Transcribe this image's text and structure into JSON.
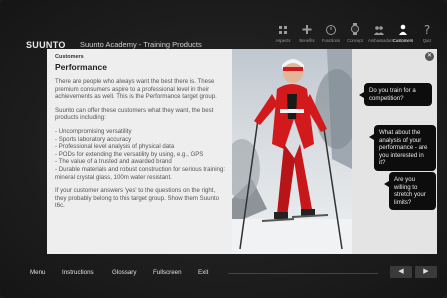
{
  "header": {
    "brand": "SUUNTO",
    "title": "Suunto Academy - Training Products",
    "nav": [
      {
        "label": "Aspects",
        "icon": "grid-icon",
        "active": false
      },
      {
        "label": "Benefits",
        "icon": "plus-icon",
        "active": false
      },
      {
        "label": "Functions",
        "icon": "stopwatch-icon",
        "active": false
      },
      {
        "label": "Concept",
        "icon": "watch-icon",
        "active": false
      },
      {
        "label": "Ambassadors",
        "icon": "people-icon",
        "active": false
      },
      {
        "label": "Customers",
        "icon": "person-icon",
        "active": true
      },
      {
        "label": "Quiz",
        "icon": "question-icon",
        "active": false
      }
    ]
  },
  "content": {
    "section_label": "Customers",
    "section_title": "Performance",
    "paragraphs": [
      "There are people who always want the best there is. These premium consumers aspire to a professional level in their achievements as well. This is the Performance target group.",
      "Suunto can offer these customers what they want, the best products including:"
    ],
    "bullets": [
      "- Uncompromising versatility",
      "- Sports laboratory accuracy",
      "- Professional level analysis of physical data",
      "- PODs for extending the versatility by using, e.g., GPS",
      "- The value of a trusted and awarded brand",
      "- Durable materials and robust construction for serious training: mineral crystal glass, 100m water resistant."
    ],
    "closing": "If your customer answers 'yes' to the questions on the right, they probably belong to this target group. Show them Suunto t6c."
  },
  "questions": [
    "Do you train for a competition?",
    "What about the analysis of your performance - are you interested in it?",
    "Are you willing to stretch your limits?"
  ],
  "footer": {
    "menu": "Menu",
    "instructions": "Instructions",
    "glossary": "Glossary",
    "fullscreen": "Fullscreen",
    "exit": "Exit",
    "prev": "◀",
    "next": "▶"
  },
  "colors": {
    "background": "#1c1c1c",
    "bubble": "#0d0d0d",
    "suit_red": "#d2191c"
  }
}
